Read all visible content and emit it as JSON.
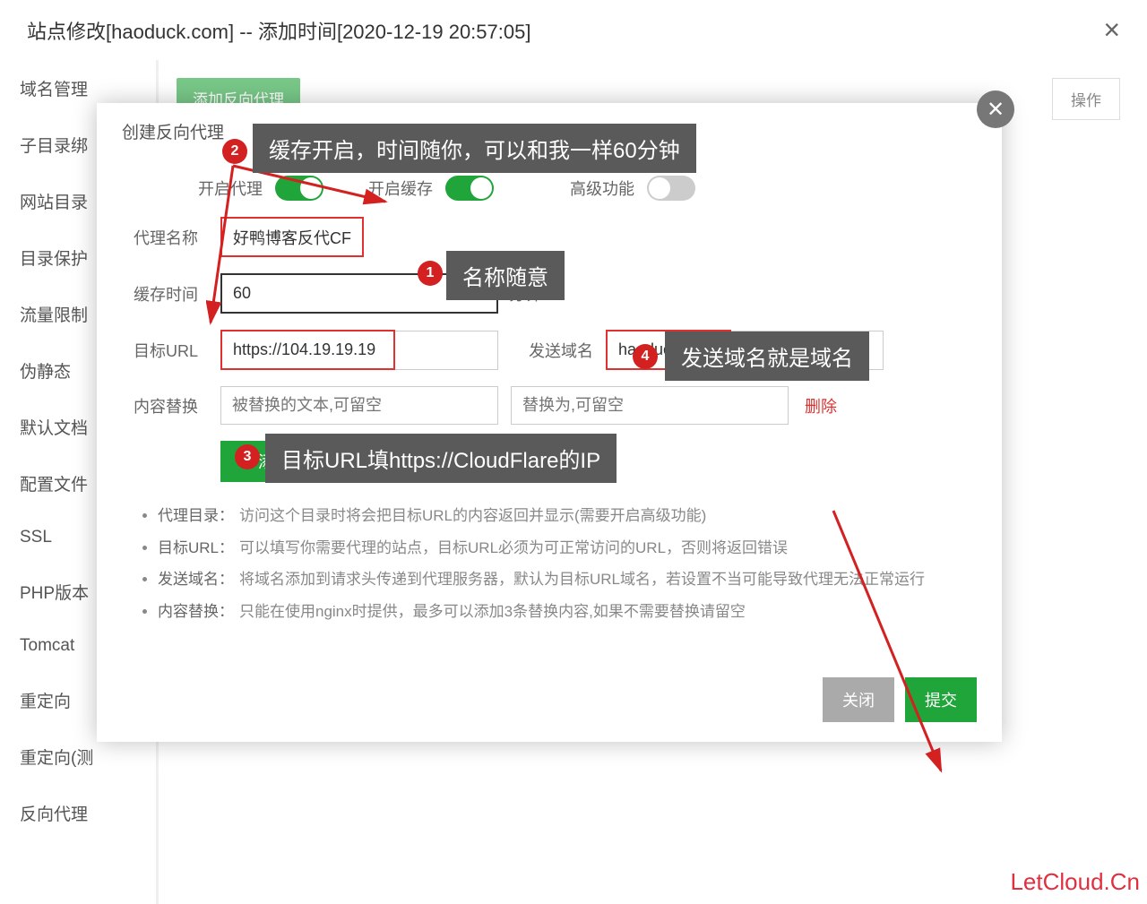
{
  "outerModal": {
    "title": "站点修改[haoduck.com] -- 添加时间[2020-12-19 20:57:05]"
  },
  "sidebar": {
    "items": [
      "域名管理",
      "子目录绑",
      "网站目录",
      "目录保护",
      "流量限制",
      "伪静态",
      "默认文档",
      "配置文件",
      "SSL",
      "PHP版本",
      "Tomcat",
      "重定向",
      "重定向(测",
      "反向代理"
    ]
  },
  "mainArea": {
    "addBtn": "添加反向代理",
    "opLabel": "操作"
  },
  "innerModal": {
    "title": "创建反向代理",
    "toggles": {
      "proxyLabel": "开启代理",
      "cacheLabel": "开启缓存",
      "advancedLabel": "高级功能"
    },
    "labels": {
      "proxyName": "代理名称",
      "cacheTime": "缓存时间",
      "targetUrl": "目标URL",
      "sendDomain": "发送域名",
      "contentReplace": "内容替换"
    },
    "values": {
      "proxyName": "好鸭博客反代CF",
      "cacheTime": "60",
      "cacheUnit": "分钟",
      "targetUrl": "https://104.19.19.19",
      "sendDomain": "haoduck.com",
      "replacement1Placeholder": "被替换的文本,可留空",
      "replacement2Placeholder": "替换为,可留空"
    },
    "deleteLink": "删除",
    "addReplaceBtn": "添加内容替换",
    "help": [
      {
        "t": "代理目录：",
        "d": "访问这个目录时将会把目标URL的内容返回并显示(需要开启高级功能)"
      },
      {
        "t": "目标URL：",
        "d": "可以填写你需要代理的站点，目标URL必须为可正常访问的URL，否则将返回错误"
      },
      {
        "t": "发送域名：",
        "d": "将域名添加到请求头传递到代理服务器，默认为目标URL域名，若设置不当可能导致代理无法正常运行"
      },
      {
        "t": "内容替换：",
        "d": "只能在使用nginx时提供，最多可以添加3条替换内容,如果不需要替换请留空"
      }
    ],
    "cancelBtn": "关闭",
    "submitBtn": "提交"
  },
  "annotations": {
    "a1": "名称随意",
    "a2": "缓存开启，时间随你，可以和我一样60分钟",
    "a3": "目标URL填https://CloudFlare的IP",
    "a4": "发送域名就是域名"
  },
  "watermark": "LetCloud.Cn"
}
